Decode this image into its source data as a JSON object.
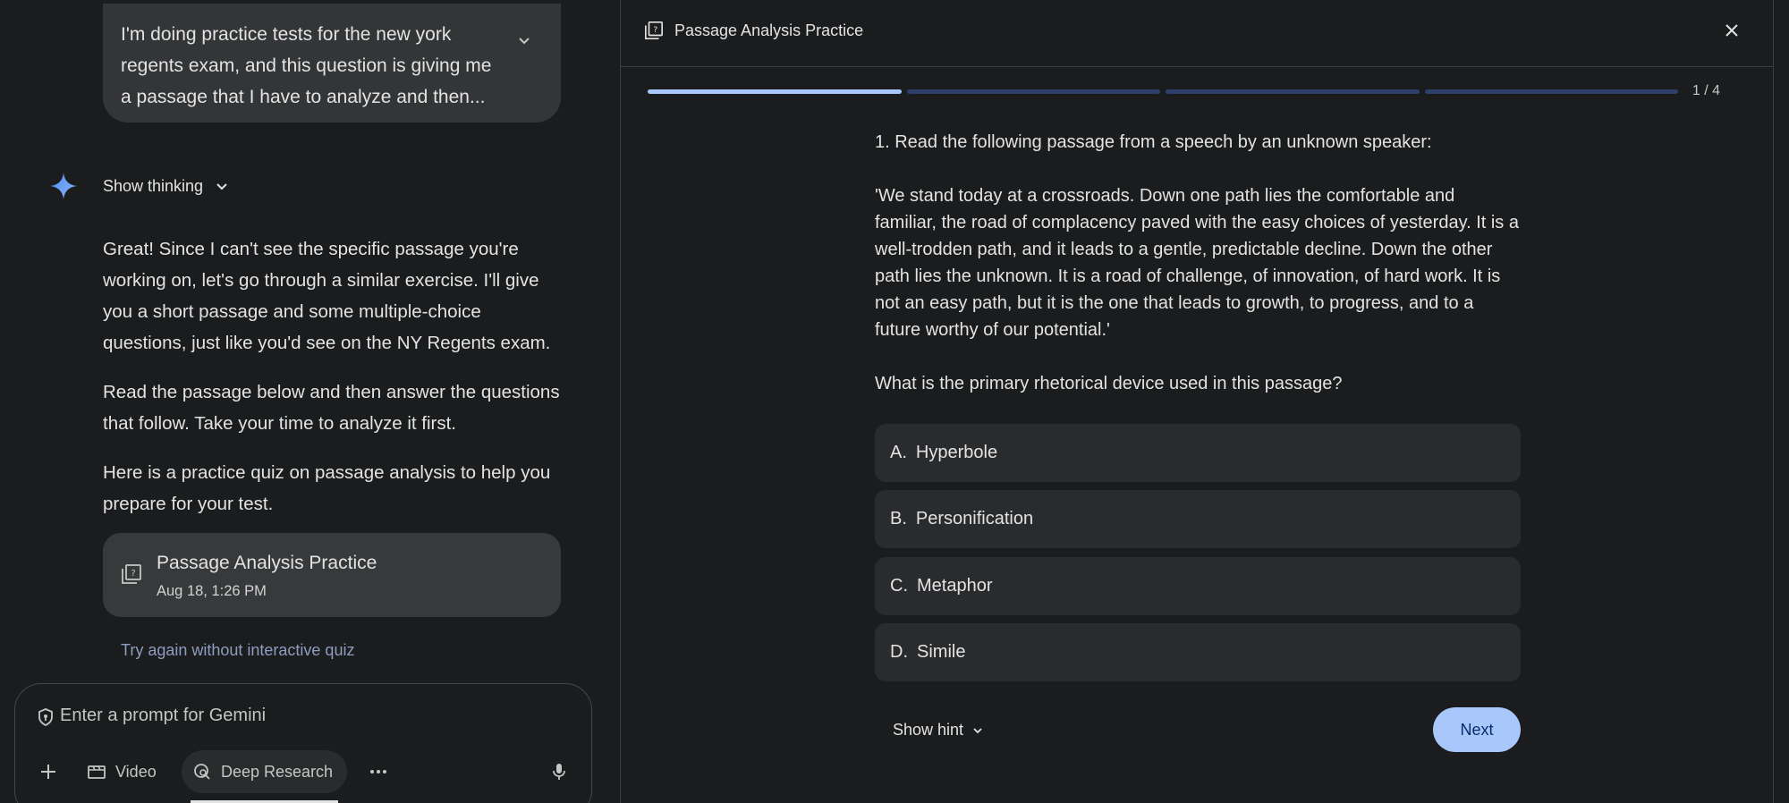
{
  "chat": {
    "user_message": "I'm doing practice tests for the new york regents exam, and this question is giving me a passage that I have to analyze and then...",
    "thinking_label": "Show thinking",
    "reply_paragraphs": [
      "Great! Since I can't see the specific passage you're working on, let's go through a similar exercise. I'll give you a short passage and some multiple-choice questions, just like you'd see on the NY Regents exam.",
      "Read the passage below and then answer the questions that follow. Take your time to analyze it first.",
      "Here is a practice quiz on passage analysis to help you prepare for your test."
    ],
    "quiz_card": {
      "title": "Passage Analysis Practice",
      "date": "Aug 18, 1:26 PM"
    },
    "try_again": "Try again without interactive quiz"
  },
  "prompt": {
    "placeholder": "Enter a prompt for Gemini",
    "tools": {
      "video": "Video",
      "deep_research": "Deep Research"
    }
  },
  "panel": {
    "title": "Passage Analysis Practice",
    "progress": {
      "current": 1,
      "total": 4,
      "label": "1 / 4"
    },
    "question_heading": "1. Read the following passage from a speech by an unknown speaker:",
    "passage": "'We stand today at a crossroads. Down one path lies the comfortable and familiar, the road of complacency paved with the easy choices of yesterday. It is a well-trodden path, and it leads to a gentle, predictable decline. Down the other path lies the unknown. It is a road of challenge, of innovation, of hard work. It is not an easy path, but it is the one that leads to growth, to progress, and to a future worthy of our potential.'",
    "prompt_question": "What is the primary rhetorical device used in this passage?",
    "options": [
      {
        "letter": "A.",
        "text": "Hyperbole"
      },
      {
        "letter": "B.",
        "text": "Personification"
      },
      {
        "letter": "C.",
        "text": "Metaphor"
      },
      {
        "letter": "D.",
        "text": "Simile"
      }
    ],
    "hint_label": "Show hint",
    "next_label": "Next"
  },
  "colors": {
    "accent": "#a8c7fa",
    "background": "#1b1c1d",
    "surface": "#2a2b2d"
  }
}
